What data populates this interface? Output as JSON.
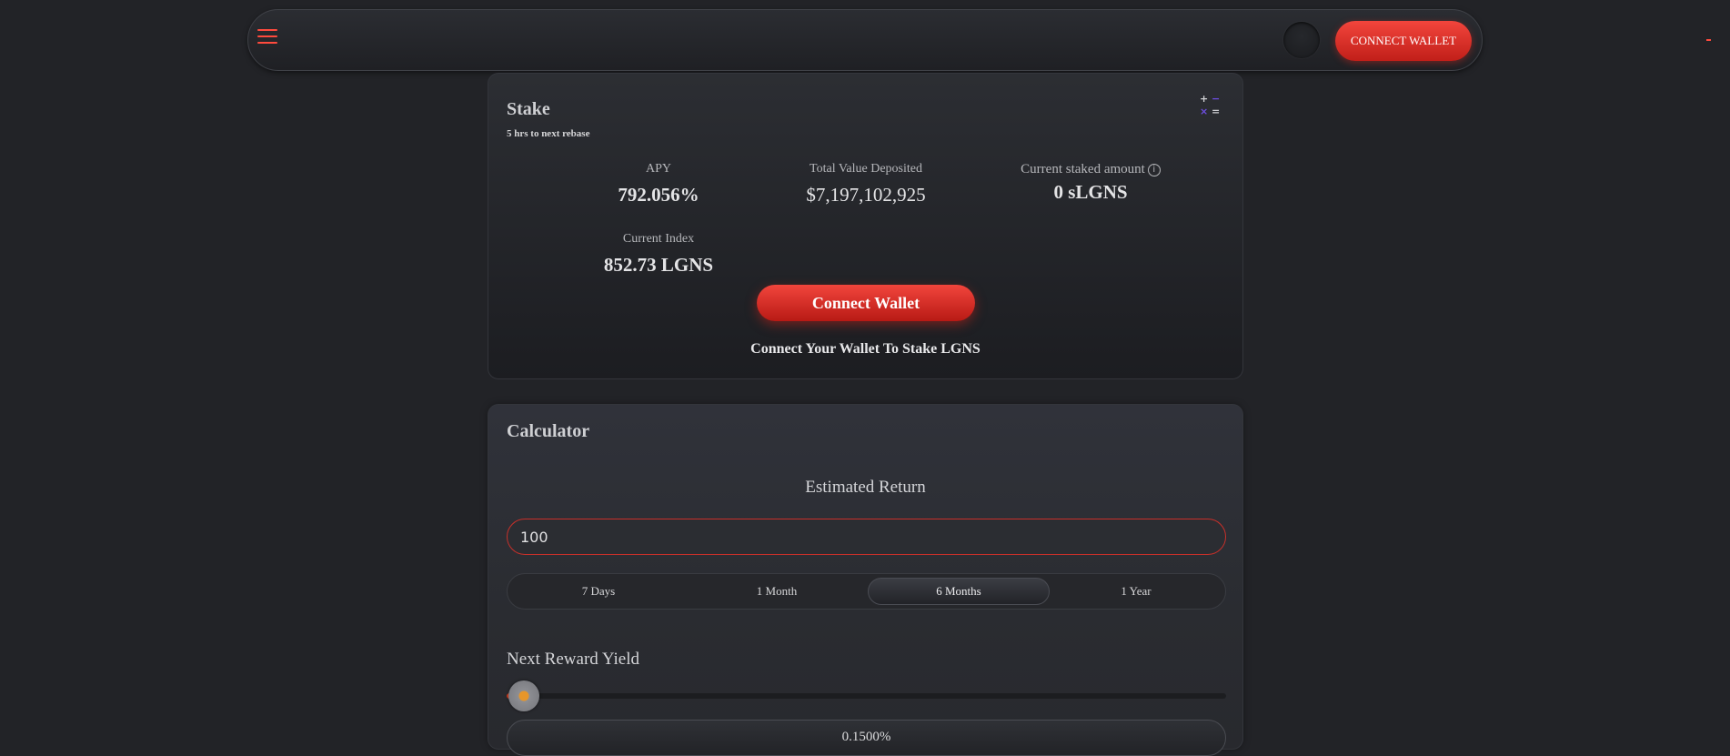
{
  "topbar": {
    "connect_label": "CONNECT WALLET",
    "accent_color": "#ff4a3d"
  },
  "stake": {
    "title": "Stake",
    "rebase": "5 hrs to next rebase",
    "apy_label": "APY",
    "apy_value": "792.056%",
    "tvd_label": "Total Value Deposited",
    "tvd_value": "$7,197,102,925",
    "current_staked_label": "Current staked amount",
    "current_staked_value": "0 sLGNS",
    "index_label": "Current Index",
    "index_value": "852.73 LGNS",
    "connect_label": "Connect Wallet",
    "connect_note": "Connect Your Wallet To Stake LGNS",
    "calc_icon_symbols": [
      "+",
      "−",
      "×",
      "="
    ],
    "calc_icon_colors": [
      "#cfd0d3",
      "#6d4ee0",
      "#6d4ee0",
      "#cfd0d3"
    ]
  },
  "calculator": {
    "title": "Calculator",
    "estimated_return": "Estimated Return",
    "amount_value": "100",
    "periods": [
      "7 Days",
      "1 Month",
      "6 Months",
      "1 Year"
    ],
    "active_period": "6 Months",
    "next_reward_label": "Next Reward Yield",
    "slider_fraction": 0.0,
    "yield_value": "0.1500%"
  }
}
